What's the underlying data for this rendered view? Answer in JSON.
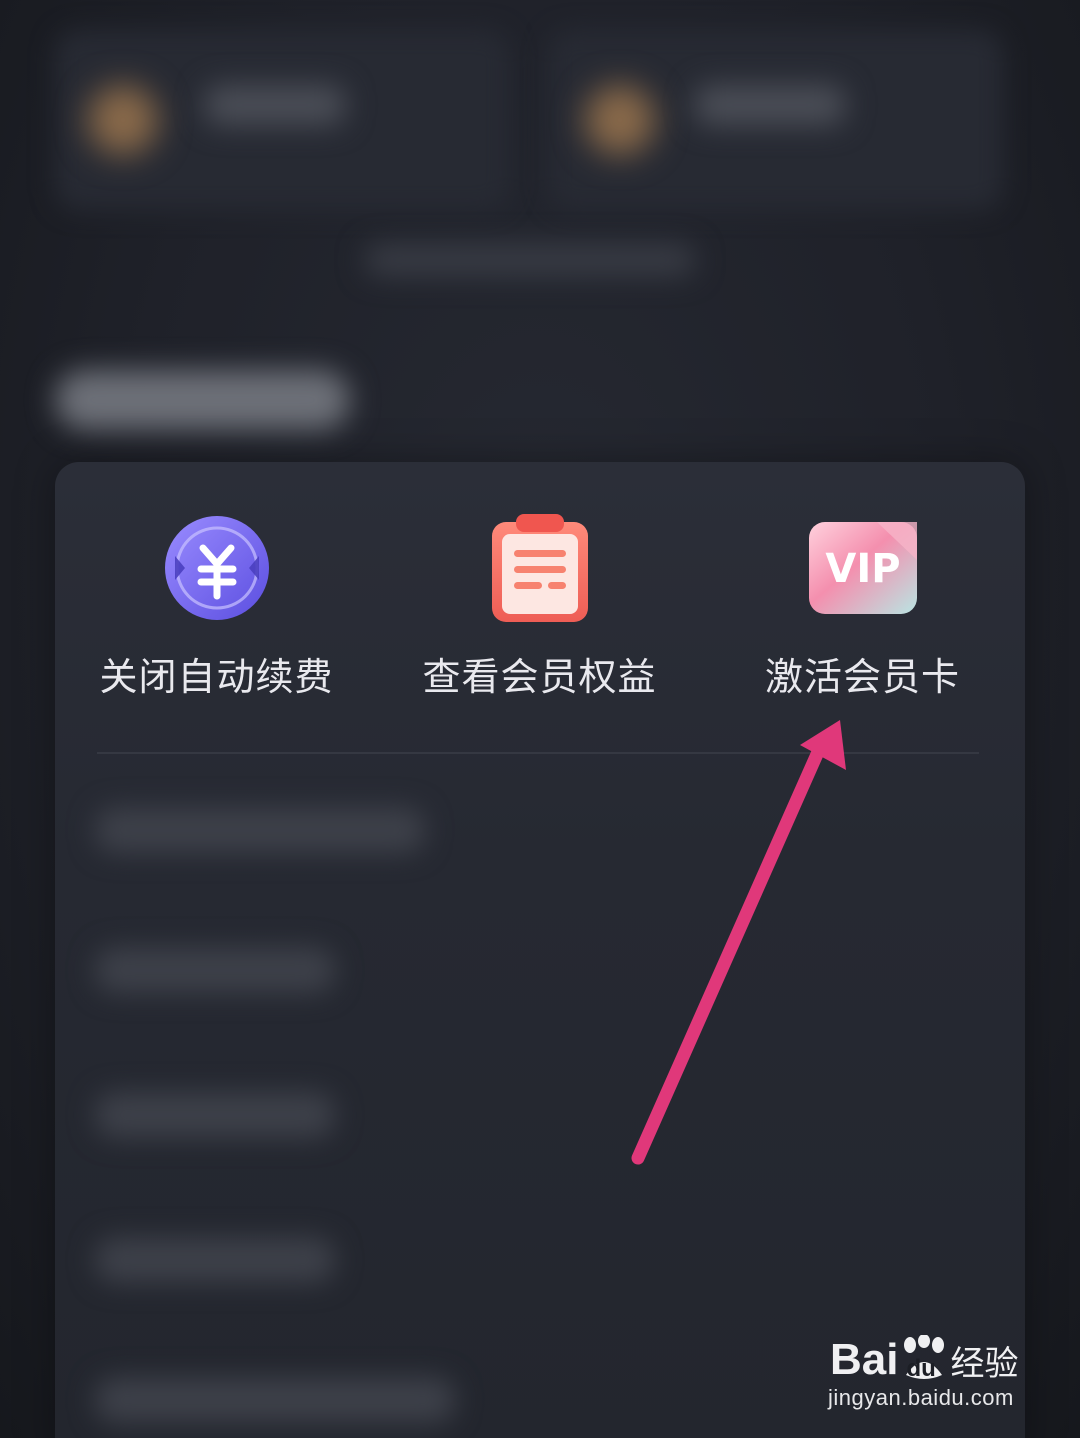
{
  "quick_actions": [
    {
      "label": "关闭自动续费",
      "icon": "yuan-coin-icon"
    },
    {
      "label": "查看会员权益",
      "icon": "clipboard-list-icon"
    },
    {
      "label": "激活会员卡",
      "icon": "vip-card-icon"
    }
  ],
  "vip_icon_text": "VIP",
  "annotation": {
    "color": "#e0387a"
  },
  "watermark": {
    "brand_latin": "Bai",
    "brand_latin_suffix": "du",
    "brand_cn": "经验",
    "url": "jingyan.baidu.com"
  },
  "colors": {
    "background": "#1c1e25",
    "card": "#2b2e38",
    "text": "#e9e9ee",
    "accent_purple": "#7b6cf0",
    "accent_red": "#f47a6e",
    "accent_pink": "#f5a3c0"
  }
}
